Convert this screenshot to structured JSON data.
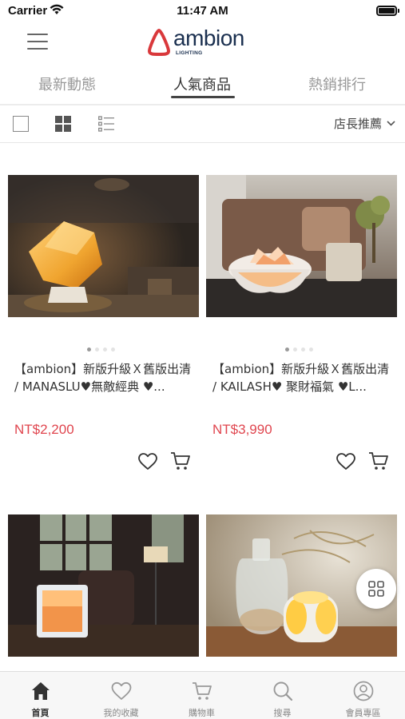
{
  "status_bar": {
    "carrier": "Carrier",
    "time": "11:47 AM"
  },
  "header": {
    "logo_text": "ambion",
    "logo_sub": "LIGHTING",
    "brand_color": "#d9383b",
    "navy": "#1a2f4f"
  },
  "tabs": [
    {
      "label": "最新動態",
      "active": false
    },
    {
      "label": "人氣商品",
      "active": true
    },
    {
      "label": "熱銷排行",
      "active": false
    }
  ],
  "view_options": {
    "sort_label": "店長推薦"
  },
  "products": [
    {
      "title": "【ambion】新版升級Ｘ舊版出清 / MANASLU♥無敵經典 ♥...",
      "price": "NT$2,200"
    },
    {
      "title": "【ambion】新版升級Ｘ舊版出清 / KAILASH♥ 聚財福氣 ♥L...",
      "price": "NT$3,990"
    },
    {
      "title": "",
      "price": ""
    },
    {
      "title": "",
      "price": ""
    }
  ],
  "tabbar": [
    {
      "label": "首頁",
      "icon": "home-icon",
      "active": true
    },
    {
      "label": "我的收藏",
      "icon": "heart-icon",
      "active": false
    },
    {
      "label": "購物車",
      "icon": "cart-icon",
      "active": false
    },
    {
      "label": "搜尋",
      "icon": "search-icon",
      "active": false
    },
    {
      "label": "會員專區",
      "icon": "user-icon",
      "active": false
    }
  ],
  "colors": {
    "price": "#e0454e",
    "accent_dark": "#333333",
    "inactive": "#999999"
  }
}
